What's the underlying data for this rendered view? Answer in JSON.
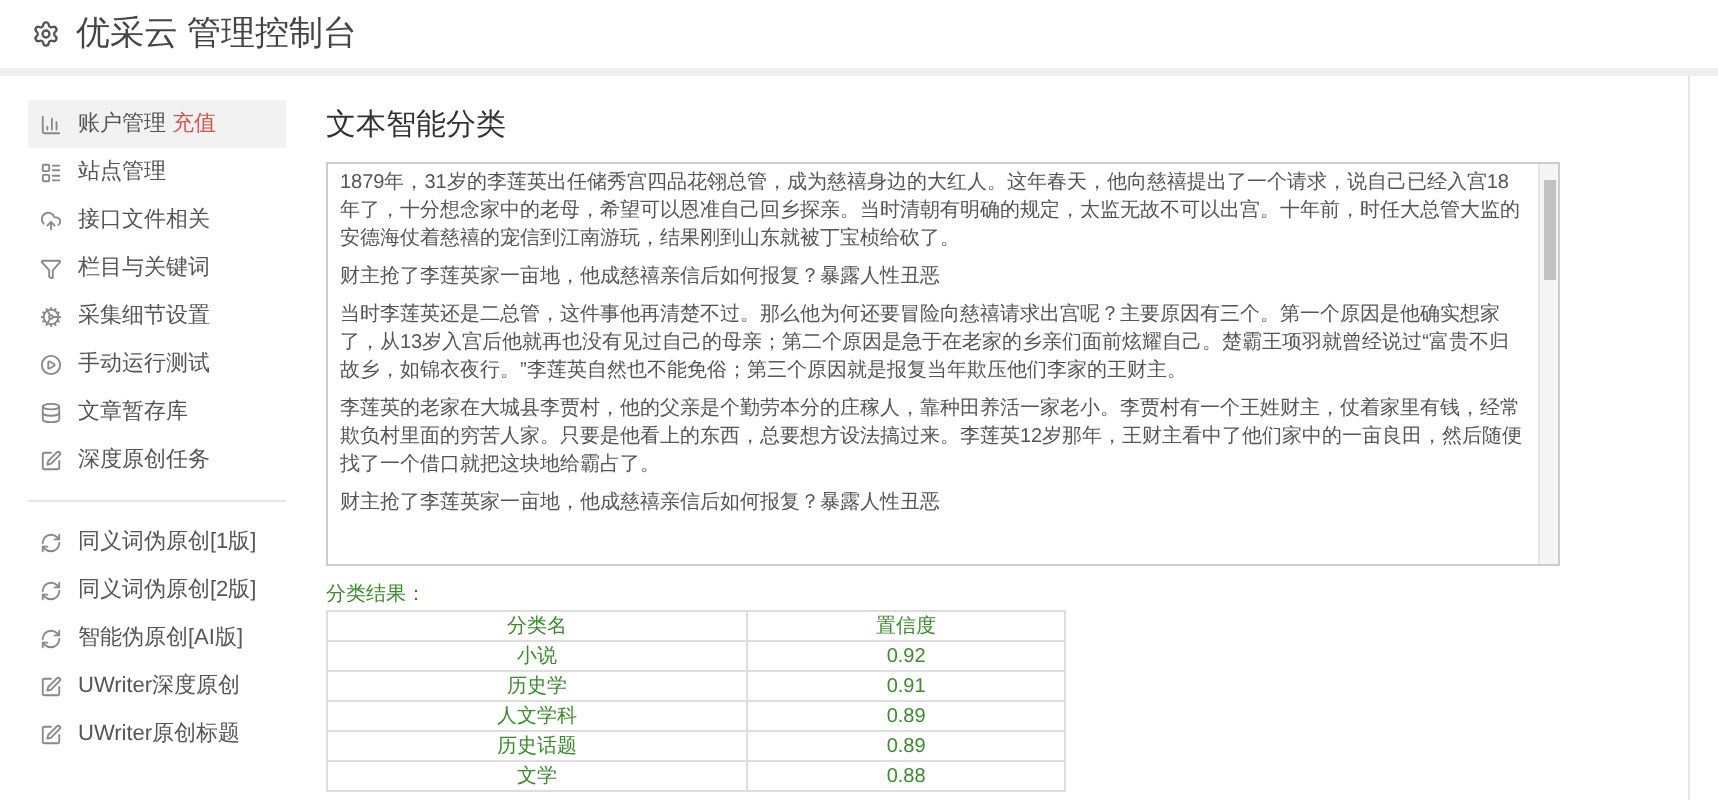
{
  "header": {
    "title": "优采云 管理控制台"
  },
  "sidebar": {
    "groups": [
      {
        "items": [
          {
            "kind": "chart",
            "label": "账户管理",
            "badge": "充值",
            "selected": true
          },
          {
            "kind": "list",
            "label": "站点管理",
            "selected": false
          },
          {
            "kind": "cloud",
            "label": "接口文件相关",
            "selected": false
          },
          {
            "kind": "filter",
            "label": "栏目与关键词",
            "selected": false
          },
          {
            "kind": "cogs",
            "label": "采集细节设置",
            "selected": false
          },
          {
            "kind": "play",
            "label": "手动运行测试",
            "selected": false
          },
          {
            "kind": "database",
            "label": "文章暂存库",
            "selected": false
          },
          {
            "kind": "edit",
            "label": "深度原创任务",
            "selected": false
          }
        ]
      },
      {
        "items": [
          {
            "kind": "refresh",
            "label": "同义词伪原创[1版]",
            "selected": false
          },
          {
            "kind": "refresh",
            "label": "同义词伪原创[2版]",
            "selected": false
          },
          {
            "kind": "refresh",
            "label": "智能伪原创[AI版]",
            "selected": false
          },
          {
            "kind": "edit",
            "label": "UWriter深度原创",
            "selected": false
          },
          {
            "kind": "edit",
            "label": "UWriter原创标题",
            "selected": false
          }
        ]
      }
    ]
  },
  "main": {
    "title": "文本智能分类",
    "text_area": {
      "paragraphs": [
        "1879年，31岁的李莲英出任储秀宫四品花翎总管，成为慈禧身边的大红人。这年春天，他向慈禧提出了一个请求，说自己已经入宫18年了，十分想念家中的老母，希望可以恩准自己回乡探亲。当时清朝有明确的规定，太监无故不可以出宫。十年前，时任大总管大监的安德海仗着慈禧的宠信到江南游玩，结果刚到山东就被丁宝桢给砍了。",
        "财主抢了李莲英家一亩地，他成慈禧亲信后如何报复？暴露人性丑恶",
        "当时李莲英还是二总管，这件事他再清楚不过。那么他为何还要冒险向慈禧请求出宫呢？主要原因有三个。第一个原因是他确实想家了，从13岁入宫后他就再也没有见过自己的母亲；第二个原因是急于在老家的乡亲们面前炫耀自己。楚霸王项羽就曾经说过“富贵不归故乡，如锦衣夜行。”李莲英自然也不能免俗；第三个原因就是报复当年欺压他们李家的王财主。",
        "李莲英的老家在大城县李贾村，他的父亲是个勤劳本分的庄稼人，靠种田养活一家老小。李贾村有一个王姓财主，仗着家里有钱，经常欺负村里面的穷苦人家。只要是他看上的东西，总要想方设法搞过来。李莲英12岁那年，王财主看中了他们家中的一亩良田，然后随便找了一个借口就把这块地给霸占了。",
        "财主抢了李莲英家一亩地，他成慈禧亲信后如何报复？暴露人性丑恶"
      ]
    },
    "result_label": "分类结果：",
    "results_table": {
      "columns": [
        "分类名",
        "置信度"
      ],
      "rows": [
        [
          "小说",
          "0.92"
        ],
        [
          "历史学",
          "0.91"
        ],
        [
          "人文学科",
          "0.89"
        ],
        [
          "历史话题",
          "0.89"
        ],
        [
          "文学",
          "0.88"
        ]
      ]
    }
  }
}
